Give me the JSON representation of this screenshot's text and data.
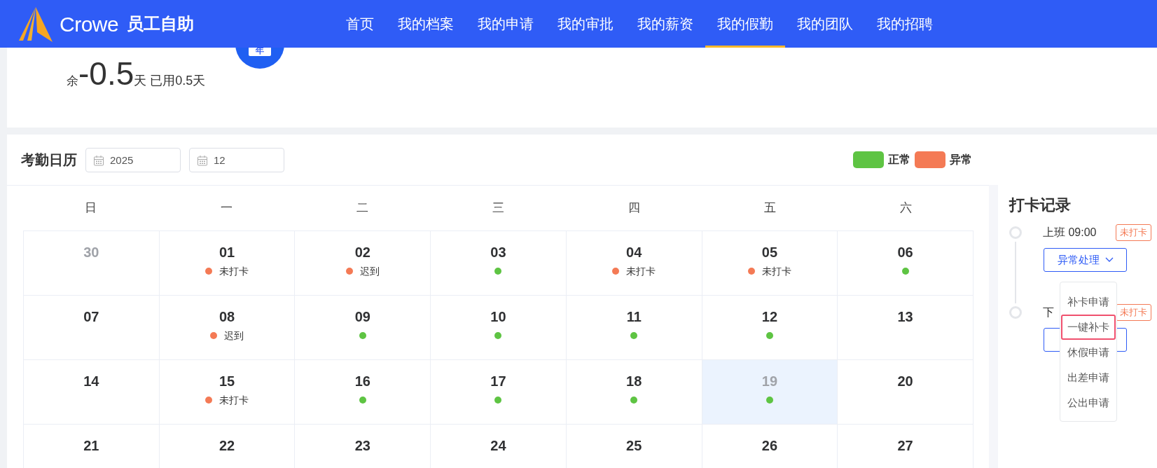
{
  "header": {
    "logo_text": "Crowe",
    "app_title": "员工自助",
    "nav": [
      {
        "label": "首页",
        "selected": false
      },
      {
        "label": "我的档案",
        "selected": false
      },
      {
        "label": "我的申请",
        "selected": false
      },
      {
        "label": "我的审批",
        "selected": false
      },
      {
        "label": "我的薪资",
        "selected": false
      },
      {
        "label": "我的假勤",
        "selected": true
      },
      {
        "label": "我的团队",
        "selected": false
      },
      {
        "label": "我的招聘",
        "selected": false
      }
    ]
  },
  "leave_summary": {
    "prefix": "余",
    "value": "-0.5",
    "unit": "天",
    "used": "已用0.5天",
    "badge": "年"
  },
  "calendar": {
    "title": "考勤日历",
    "year_field": {
      "value": "2025"
    },
    "month_field": {
      "value": "12"
    },
    "legend": [
      {
        "label": "正常",
        "color": "#5ec443"
      },
      {
        "label": "异常",
        "color": "#f47a55"
      }
    ],
    "weekdays": [
      "日",
      "一",
      "二",
      "三",
      "四",
      "五",
      "六"
    ],
    "weeks": [
      [
        {
          "day": "30",
          "muted": true,
          "selected": false
        },
        {
          "day": "01",
          "muted": false,
          "selected": false,
          "mark": {
            "color": "#f47a55",
            "label": "未打卡"
          }
        },
        {
          "day": "02",
          "muted": false,
          "selected": false,
          "mark": {
            "color": "#f47a55",
            "label": "迟到"
          }
        },
        {
          "day": "03",
          "muted": false,
          "selected": false,
          "mark": {
            "color": "#5ec443"
          }
        },
        {
          "day": "04",
          "muted": false,
          "selected": false,
          "mark": {
            "color": "#f47a55",
            "label": "未打卡"
          }
        },
        {
          "day": "05",
          "muted": false,
          "selected": false,
          "mark": {
            "color": "#f47a55",
            "label": "未打卡"
          }
        },
        {
          "day": "06",
          "muted": false,
          "selected": false,
          "mark": {
            "color": "#5ec443"
          }
        }
      ],
      [
        {
          "day": "07",
          "muted": false,
          "selected": false
        },
        {
          "day": "08",
          "muted": false,
          "selected": false,
          "mark": {
            "color": "#f47a55",
            "label": "迟到"
          }
        },
        {
          "day": "09",
          "muted": false,
          "selected": false,
          "mark": {
            "color": "#5ec443"
          }
        },
        {
          "day": "10",
          "muted": false,
          "selected": false,
          "mark": {
            "color": "#5ec443"
          }
        },
        {
          "day": "11",
          "muted": false,
          "selected": false,
          "mark": {
            "color": "#5ec443"
          }
        },
        {
          "day": "12",
          "muted": false,
          "selected": false,
          "mark": {
            "color": "#5ec443"
          }
        },
        {
          "day": "13",
          "muted": false,
          "selected": false
        }
      ],
      [
        {
          "day": "14",
          "muted": false,
          "selected": false
        },
        {
          "day": "15",
          "muted": false,
          "selected": false,
          "mark": {
            "color": "#f47a55",
            "label": "未打卡"
          }
        },
        {
          "day": "16",
          "muted": false,
          "selected": false,
          "mark": {
            "color": "#5ec443"
          }
        },
        {
          "day": "17",
          "muted": false,
          "selected": false,
          "mark": {
            "color": "#5ec443"
          }
        },
        {
          "day": "18",
          "muted": false,
          "selected": false,
          "mark": {
            "color": "#5ec443"
          }
        },
        {
          "day": "19",
          "muted": true,
          "selected": true,
          "mark": {
            "color": "#5ec443"
          }
        },
        {
          "day": "20",
          "muted": false,
          "selected": false
        }
      ],
      [
        {
          "day": "21",
          "muted": false,
          "selected": false
        },
        {
          "day": "22",
          "muted": false,
          "selected": false
        },
        {
          "day": "23",
          "muted": false,
          "selected": false
        },
        {
          "day": "24",
          "muted": false,
          "selected": false
        },
        {
          "day": "25",
          "muted": false,
          "selected": false
        },
        {
          "day": "26",
          "muted": false,
          "selected": false
        },
        {
          "day": "27",
          "muted": false,
          "selected": false
        }
      ]
    ]
  },
  "punch_record": {
    "title": "打卡记录",
    "entries": [
      {
        "label": "上班 09:00",
        "status": "未打卡",
        "button_label": "异常处理"
      },
      {
        "label": "下",
        "status": "未打卡"
      }
    ],
    "menu": {
      "expanded": true,
      "items": [
        {
          "label": "补卡申请",
          "selected": false
        },
        {
          "label": "一键补卡",
          "selected": true
        },
        {
          "label": "休假申请",
          "selected": false
        },
        {
          "label": "出差申请",
          "selected": false
        },
        {
          "label": "公出申请",
          "selected": false
        }
      ]
    }
  }
}
